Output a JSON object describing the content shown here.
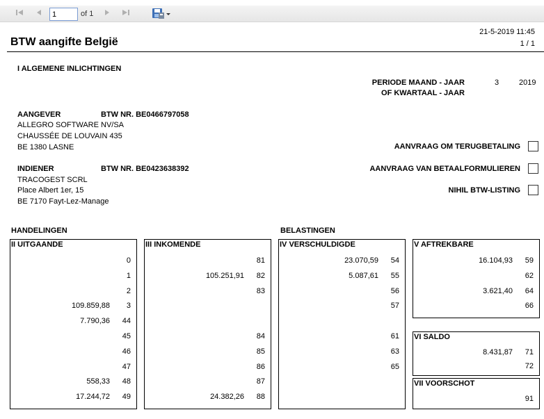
{
  "toolbar": {
    "page_value": "1",
    "of_label": "of 1",
    "icons": [
      "first-page-icon",
      "previous-page-icon",
      "next-page-icon",
      "last-page-icon",
      "save-export-icon"
    ]
  },
  "header": {
    "title": "BTW aangifte België",
    "datetime": "21-5-2019 11:45",
    "page_count": "1 / 1"
  },
  "general": {
    "section_title": "I  ALGEMENE INLICHTINGEN",
    "periode_label": "PERIODE MAAND - JAAR",
    "kwartaal_label": "OF KWARTAAL - JAAR",
    "month": "3",
    "year": "2019",
    "aangever_label": "AANGEVER",
    "aangever_btw": "BTW NR. BE0466797058",
    "aangever_lines": [
      "ALLEGRO SOFTWARE NV/SA",
      "CHAUSSÉE DE LOUVAIN 435",
      "BE 1380 LASNE"
    ],
    "indiener_label": "INDIENER",
    "indiener_btw": "BTW NR. BE0423638392",
    "indiener_lines": [
      "TRACOGEST SCRL",
      "Place Albert 1er, 15",
      "BE 7170 Fayt-Lez-Manage"
    ],
    "checkboxes": [
      {
        "label": "AANVRAAG OM TERUGBETALING",
        "checked": false
      },
      {
        "label": "AANVRAAG VAN BETAALFORMULIEREN",
        "checked": false
      },
      {
        "label": "NIHIL BTW-LISTING",
        "checked": false
      }
    ]
  },
  "handelingen_title": "HANDELINGEN",
  "belastingen_title": "BELASTINGEN",
  "boxes": {
    "uitgaande": {
      "title": "II UITGAANDE",
      "rows": [
        {
          "value": "",
          "code": "0"
        },
        {
          "value": "",
          "code": "1"
        },
        {
          "value": "",
          "code": "2"
        },
        {
          "value": "109.859,88",
          "code": "3"
        },
        {
          "value": "7.790,36",
          "code": "44"
        },
        {
          "value": "",
          "code": "45"
        },
        {
          "value": "",
          "code": "46"
        },
        {
          "value": "",
          "code": "47"
        },
        {
          "value": "558,33",
          "code": "48"
        },
        {
          "value": "17.244,72",
          "code": "49"
        }
      ]
    },
    "inkomende": {
      "title": "III INKOMENDE",
      "rows": [
        {
          "value": "",
          "code": "81"
        },
        {
          "value": "105.251,91",
          "code": "82"
        },
        {
          "value": "",
          "code": "83"
        },
        {
          "value": "",
          "code": ""
        },
        {
          "value": "",
          "code": ""
        },
        {
          "value": "",
          "code": "84"
        },
        {
          "value": "",
          "code": "85"
        },
        {
          "value": "",
          "code": "86"
        },
        {
          "value": "",
          "code": "87"
        },
        {
          "value": "24.382,26",
          "code": "88"
        }
      ]
    },
    "verschuldigde": {
      "title": "IV VERSCHULDIGDE",
      "rows": [
        {
          "value": "23.070,59",
          "code": "54"
        },
        {
          "value": "5.087,61",
          "code": "55"
        },
        {
          "value": "",
          "code": "56"
        },
        {
          "value": "",
          "code": "57"
        },
        {
          "value": "",
          "code": ""
        },
        {
          "value": "",
          "code": "61"
        },
        {
          "value": "",
          "code": "63"
        },
        {
          "value": "",
          "code": "65"
        }
      ]
    },
    "aftrekbare": {
      "title": "V AFTREKBARE",
      "rows": [
        {
          "value": "16.104,93",
          "code": "59"
        },
        {
          "value": "",
          "code": "62"
        },
        {
          "value": "3.621,40",
          "code": "64"
        },
        {
          "value": "",
          "code": "66"
        }
      ]
    },
    "saldo": {
      "title": "VI SALDO",
      "rows": [
        {
          "value": "8.431,87",
          "code": "71"
        },
        {
          "value": "",
          "code": "72"
        }
      ]
    },
    "voorschot": {
      "title": "VII VOORSCHOT",
      "rows": [
        {
          "value": "",
          "code": "91"
        }
      ]
    }
  }
}
